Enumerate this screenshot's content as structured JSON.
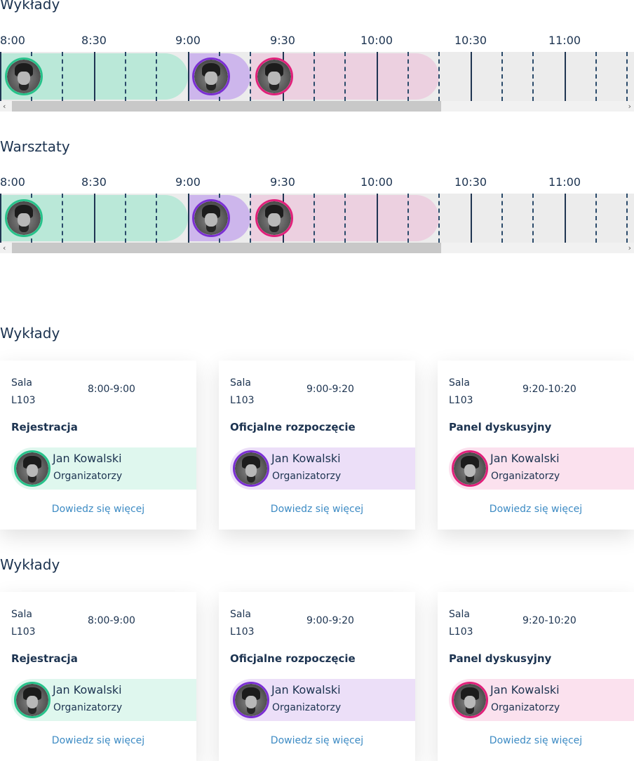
{
  "sections": {
    "timeline1_title": "Wykłady",
    "timeline2_title": "Warsztaty",
    "cards1_title": "Wykłady",
    "cards2_title": "Wykłady"
  },
  "timeline": {
    "labels": [
      "8:00",
      "8:30",
      "9:00",
      "9:30",
      "10:00",
      "10:30",
      "11:00"
    ]
  },
  "cards": [
    {
      "sala_label": "Sala",
      "room": "L103",
      "time": "8:00-9:00",
      "title": "Rejestracja",
      "speaker": "Jan Kowalski",
      "role": "Organizatorzy",
      "link": "Dowiedz się więcej",
      "color": "#27c28a",
      "bg": "#dff7ee"
    },
    {
      "sala_label": "Sala",
      "room": "L103",
      "time": "9:00-9:20",
      "title": "Oficjalne rozpoczęcie",
      "speaker": "Jan Kowalski",
      "role": "Organizatorzy",
      "link": "Dowiedz się więcej",
      "color": "#7b2fd3",
      "bg": "#ecdff8"
    },
    {
      "sala_label": "Sala",
      "room": "L103",
      "time": "9:20-10:20",
      "title": "Panel dyskusyjny",
      "speaker": "Jan Kowalski",
      "role": "Organizatorzy",
      "link": "Dowiedz się więcej",
      "color": "#e0207a",
      "bg": "#fbe1ee"
    }
  ],
  "colors": {
    "green": "#27c28a",
    "purple": "#7b2fd3",
    "pink": "#e0207a",
    "green_block": "#bae8d8",
    "purple_block": "#cdb6ec",
    "pink_block": "#ecd0e0",
    "link": "#3d8bc4",
    "text": "#1c3350"
  }
}
